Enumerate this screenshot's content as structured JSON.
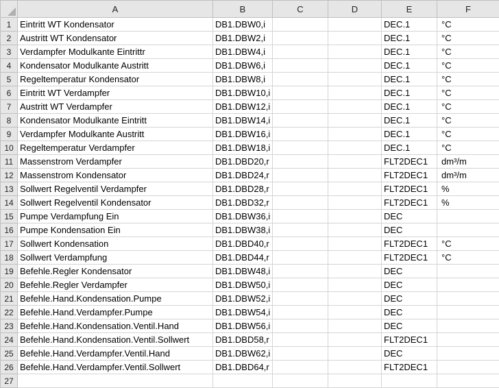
{
  "columns": [
    "A",
    "B",
    "C",
    "D",
    "E",
    "F"
  ],
  "rows": [
    {
      "n": "1",
      "a": "Eintritt WT Kondensator",
      "b": "DB1.DBW0,i",
      "c": "",
      "d": "",
      "e": "DEC.1",
      "f": "°C"
    },
    {
      "n": "2",
      "a": "Austritt  WT Kondensator",
      "b": "DB1.DBW2,i",
      "c": "",
      "d": "",
      "e": "DEC.1",
      "f": "°C"
    },
    {
      "n": "3",
      "a": "Verdampfer Modulkante Eintrittr",
      "b": "DB1.DBW4,i",
      "c": "",
      "d": "",
      "e": "DEC.1",
      "f": "°C"
    },
    {
      "n": "4",
      "a": "Kondensator Modulkante Austritt",
      "b": "DB1.DBW6,i",
      "c": "",
      "d": "",
      "e": "DEC.1",
      "f": "°C"
    },
    {
      "n": "5",
      "a": "Regeltemperatur Kondensator",
      "b": "DB1.DBW8,i",
      "c": "",
      "d": "",
      "e": "DEC.1",
      "f": "°C"
    },
    {
      "n": "6",
      "a": "Eintritt WT Verdampfer",
      "b": "DB1.DBW10,i",
      "c": "",
      "d": "",
      "e": "DEC.1",
      "f": "°C"
    },
    {
      "n": "7",
      "a": "Austritt WT Verdampfer",
      "b": "DB1.DBW12,i",
      "c": "",
      "d": "",
      "e": "DEC.1",
      "f": "°C"
    },
    {
      "n": "8",
      "a": "Kondensator Modulkante Eintritt",
      "b": "DB1.DBW14,i",
      "c": "",
      "d": "",
      "e": "DEC.1",
      "f": "°C"
    },
    {
      "n": "9",
      "a": "Verdampfer Modulkante Austritt",
      "b": "DB1.DBW16,i",
      "c": "",
      "d": "",
      "e": "DEC.1",
      "f": "°C"
    },
    {
      "n": "10",
      "a": "Regeltemperatur Verdampfer",
      "b": "DB1.DBW18,i",
      "c": "",
      "d": "",
      "e": "DEC.1",
      "f": "°C"
    },
    {
      "n": "11",
      "a": "Massenstrom Verdampfer",
      "b": "DB1.DBD20,r",
      "c": "",
      "d": "",
      "e": "FLT2DEC1",
      "f": "dm³/m"
    },
    {
      "n": "12",
      "a": "Massenstrom Kondensator",
      "b": "DB1.DBD24,r",
      "c": "",
      "d": "",
      "e": "FLT2DEC1",
      "f": "dm³/m"
    },
    {
      "n": "13",
      "a": "Sollwert Regelventil Verdampfer",
      "b": "DB1.DBD28,r",
      "c": "",
      "d": "",
      "e": "FLT2DEC1",
      "f": "%"
    },
    {
      "n": "14",
      "a": "Sollwert Regelventil Kondensator",
      "b": "DB1.DBD32,r",
      "c": "",
      "d": "",
      "e": "FLT2DEC1",
      "f": "%"
    },
    {
      "n": "15",
      "a": "Pumpe Verdampfung Ein",
      "b": "DB1.DBW36,i",
      "c": "",
      "d": "",
      "e": "DEC",
      "f": ""
    },
    {
      "n": "16",
      "a": "Pumpe Kondensation Ein",
      "b": "DB1.DBW38,i",
      "c": "",
      "d": "",
      "e": "DEC",
      "f": ""
    },
    {
      "n": "17",
      "a": "Sollwert Kondensation",
      "b": "DB1.DBD40,r",
      "c": "",
      "d": "",
      "e": "FLT2DEC1",
      "f": "°C"
    },
    {
      "n": "18",
      "a": "Sollwert Verdampfung",
      "b": "DB1.DBD44,r",
      "c": "",
      "d": "",
      "e": "FLT2DEC1",
      "f": "°C"
    },
    {
      "n": "19",
      "a": "Befehle.Regler Kondensator",
      "b": "DB1.DBW48,i",
      "c": "",
      "d": "",
      "e": "DEC",
      "f": ""
    },
    {
      "n": "20",
      "a": "Befehle.Regler Verdampfer",
      "b": "DB1.DBW50,i",
      "c": "",
      "d": "",
      "e": "DEC",
      "f": ""
    },
    {
      "n": "21",
      "a": "Befehle.Hand.Kondensation.Pumpe",
      "b": "DB1.DBW52,i",
      "c": "",
      "d": "",
      "e": "DEC",
      "f": ""
    },
    {
      "n": "22",
      "a": "Befehle.Hand.Verdampfer.Pumpe",
      "b": "DB1.DBW54,i",
      "c": "",
      "d": "",
      "e": "DEC",
      "f": ""
    },
    {
      "n": "23",
      "a": "Befehle.Hand.Kondensation.Ventil.Hand",
      "b": "DB1.DBW56,i",
      "c": "",
      "d": "",
      "e": "DEC",
      "f": ""
    },
    {
      "n": "24",
      "a": "Befehle.Hand.Kondensation.Ventil.Sollwert",
      "b": "DB1.DBD58,r",
      "c": "",
      "d": "",
      "e": "FLT2DEC1",
      "f": ""
    },
    {
      "n": "25",
      "a": "Befehle.Hand.Verdampfer.Ventil.Hand",
      "b": "DB1.DBW62,i",
      "c": "",
      "d": "",
      "e": "DEC",
      "f": ""
    },
    {
      "n": "26",
      "a": "Befehle.Hand.Verdampfer.Ventil.Sollwert",
      "b": "DB1.DBD64,r",
      "c": "",
      "d": "",
      "e": "FLT2DEC1",
      "f": ""
    },
    {
      "n": "27",
      "a": "",
      "b": "",
      "c": "",
      "d": "",
      "e": "",
      "f": ""
    }
  ]
}
